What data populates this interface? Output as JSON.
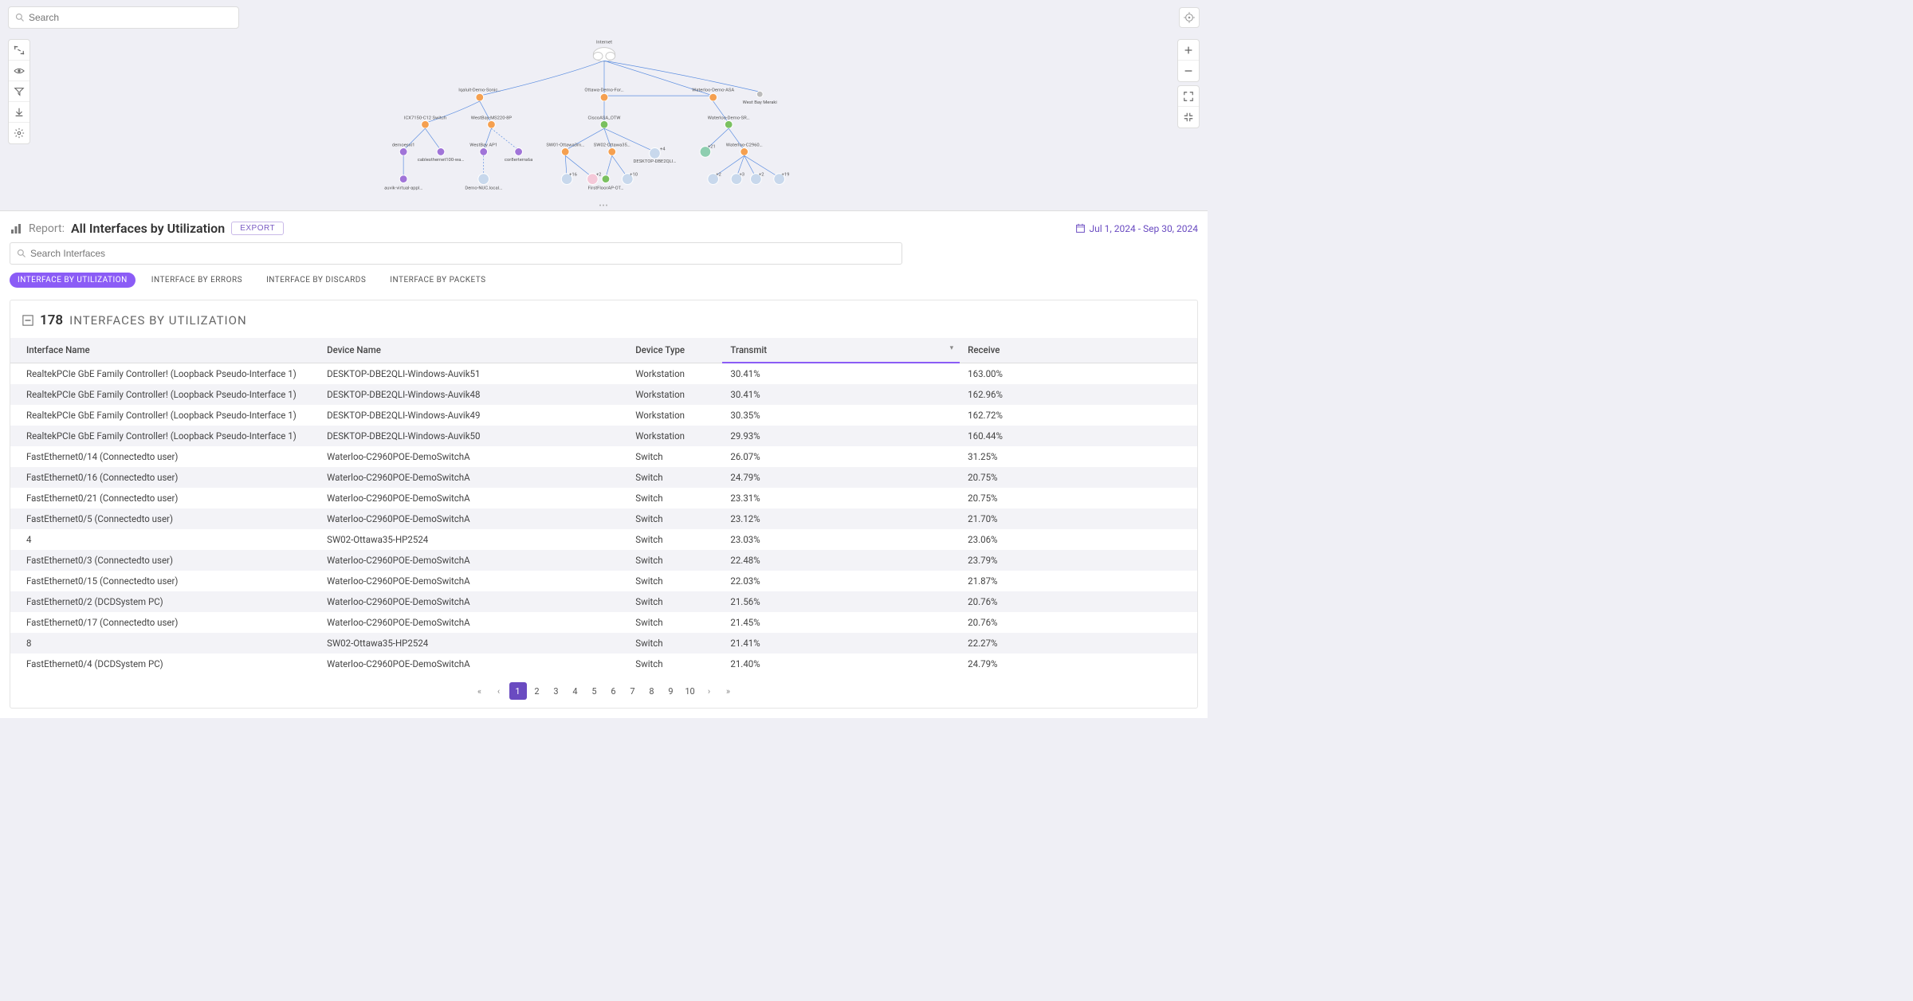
{
  "search": {
    "placeholder": "Search"
  },
  "topology": {
    "root_label": "Internet",
    "nodes_l2": [
      {
        "label": "Iqaluit-Demo-Sonic…"
      },
      {
        "label": "Ottawa-Demo-For…"
      },
      {
        "label": "Waterloo-Demo-ASA"
      },
      {
        "label": "West Bay Meraki"
      }
    ],
    "nodes_l3": [
      {
        "label": "ICX7150-C12 Switch"
      },
      {
        "label": "WestBay-MS220-8P"
      },
      {
        "label": "CiscoASA_OTW"
      },
      {
        "label": "Waterloo-Demo-SR…"
      }
    ],
    "nodes_l4_left": [
      {
        "label": "demoesxi1"
      },
      {
        "label": "cablesthernet100-wa…"
      },
      {
        "label": "WestBay AP1"
      },
      {
        "label": "cor8erterra6a"
      }
    ],
    "nodes_l4_mid": [
      {
        "label": "SW01-Ottawa3m…"
      },
      {
        "label": "SW02-Ottawa35…"
      },
      {
        "label": "DESKTOP-DBE2QLI…"
      }
    ],
    "nodes_l4_right": [
      {
        "label": "Waterloo-C2960…"
      }
    ],
    "nodes_l5": [
      {
        "label": "auvik-virtual-appl…"
      },
      {
        "label": "Demo-NUC.local…"
      },
      {
        "label": "FirstFloorAP-OT…"
      }
    ]
  },
  "report": {
    "prefix": "Report:",
    "name": "All Interfaces by Utilization",
    "export_label": "EXPORT",
    "date_range": "Jul 1, 2024 - Sep 30, 2024",
    "search_placeholder": "Search Interfaces"
  },
  "tabs": [
    {
      "label": "INTERFACE BY UTILIZATION",
      "active": true
    },
    {
      "label": "INTERFACE BY ERRORS",
      "active": false
    },
    {
      "label": "INTERFACE BY DISCARDS",
      "active": false
    },
    {
      "label": "INTERFACE BY PACKETS",
      "active": false
    }
  ],
  "table": {
    "count": "178",
    "title": "INTERFACES BY UTILIZATION",
    "columns": [
      "Interface Name",
      "Device Name",
      "Device Type",
      "Transmit",
      "Receive"
    ],
    "sorted_col_index": 3,
    "rows": [
      [
        "RealtekPCIe GbE Family Controller! (Loopback Pseudo-Interface 1)",
        "DESKTOP-DBE2QLI-Windows-Auvik51",
        "Workstation",
        "30.41%",
        "163.00%"
      ],
      [
        "RealtekPCIe GbE Family Controller! (Loopback Pseudo-Interface 1)",
        "DESKTOP-DBE2QLI-Windows-Auvik48",
        "Workstation",
        "30.41%",
        "162.96%"
      ],
      [
        "RealtekPCIe GbE Family Controller! (Loopback Pseudo-Interface 1)",
        "DESKTOP-DBE2QLI-Windows-Auvik49",
        "Workstation",
        "30.35%",
        "162.72%"
      ],
      [
        "RealtekPCIe GbE Family Controller! (Loopback Pseudo-Interface 1)",
        "DESKTOP-DBE2QLI-Windows-Auvik50",
        "Workstation",
        "29.93%",
        "160.44%"
      ],
      [
        "FastEthernet0/14 (Connectedto user)",
        "Waterloo-C2960POE-DemoSwitchA",
        "Switch",
        "26.07%",
        "31.25%"
      ],
      [
        "FastEthernet0/16 (Connectedto user)",
        "Waterloo-C2960POE-DemoSwitchA",
        "Switch",
        "24.79%",
        "20.75%"
      ],
      [
        "FastEthernet0/21 (Connectedto user)",
        "Waterloo-C2960POE-DemoSwitchA",
        "Switch",
        "23.31%",
        "20.75%"
      ],
      [
        "FastEthernet0/5 (Connectedto user)",
        "Waterloo-C2960POE-DemoSwitchA",
        "Switch",
        "23.12%",
        "21.70%"
      ],
      [
        "4",
        "SW02-Ottawa35-HP2524",
        "Switch",
        "23.03%",
        "23.06%"
      ],
      [
        "FastEthernet0/3 (Connectedto user)",
        "Waterloo-C2960POE-DemoSwitchA",
        "Switch",
        "22.48%",
        "23.79%"
      ],
      [
        "FastEthernet0/15 (Connectedto user)",
        "Waterloo-C2960POE-DemoSwitchA",
        "Switch",
        "22.03%",
        "21.87%"
      ],
      [
        "FastEthernet0/2 (DCDSystem PC)",
        "Waterloo-C2960POE-DemoSwitchA",
        "Switch",
        "21.56%",
        "20.76%"
      ],
      [
        "FastEthernet0/17 (Connectedto user)",
        "Waterloo-C2960POE-DemoSwitchA",
        "Switch",
        "21.45%",
        "20.76%"
      ],
      [
        "8",
        "SW02-Ottawa35-HP2524",
        "Switch",
        "21.41%",
        "22.27%"
      ],
      [
        "FastEthernet0/4 (DCDSystem PC)",
        "Waterloo-C2960POE-DemoSwitchA",
        "Switch",
        "21.40%",
        "24.79%"
      ]
    ]
  },
  "pagination": {
    "pages": [
      "1",
      "2",
      "3",
      "4",
      "5",
      "6",
      "7",
      "8",
      "9",
      "10"
    ],
    "active": 1
  }
}
